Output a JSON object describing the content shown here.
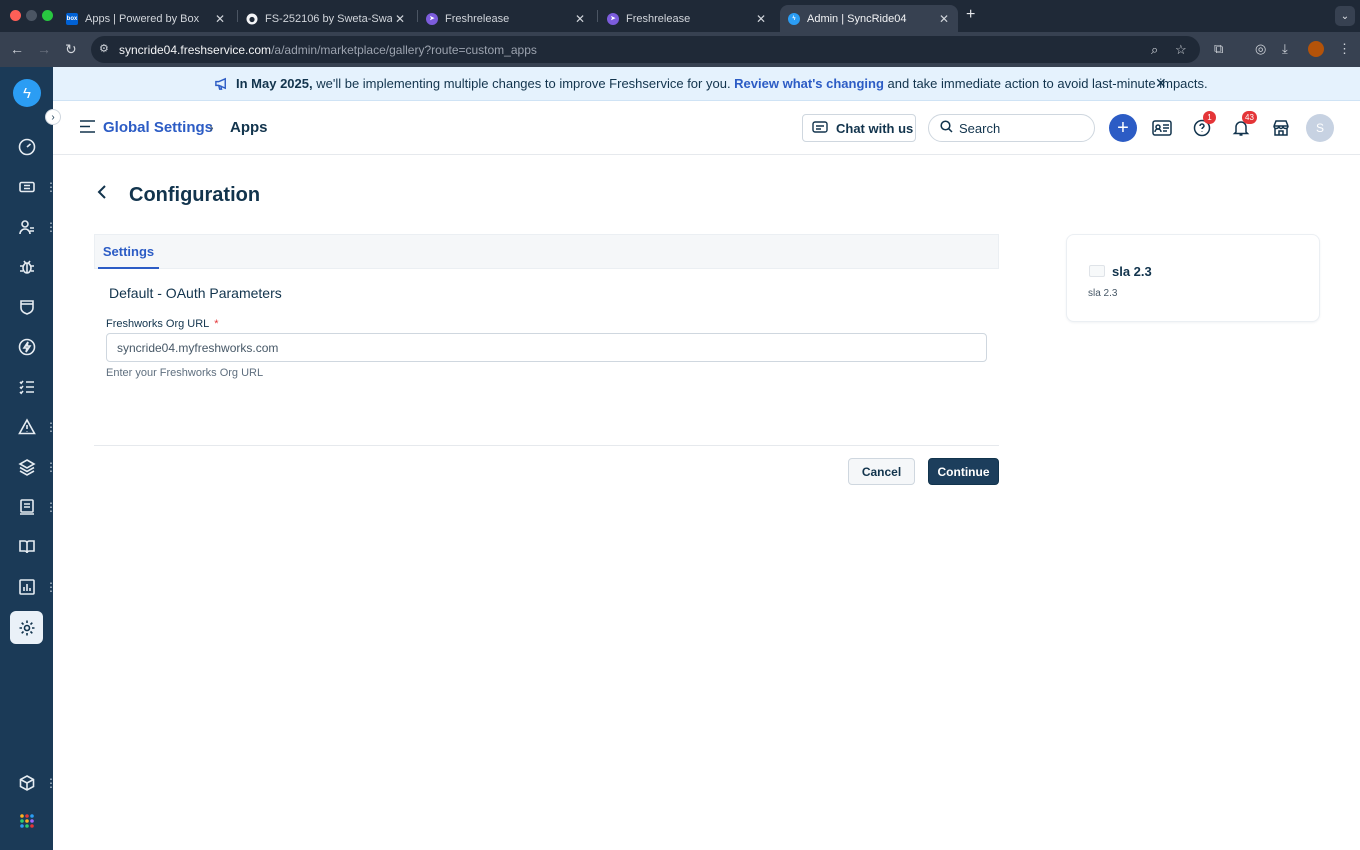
{
  "browser": {
    "tabs": [
      {
        "title": "Apps | Powered by Box",
        "favicon": "box-icon",
        "active": false
      },
      {
        "title": "FS-252106 by Sweta-Swarnam",
        "favicon": "github-icon",
        "active": false
      },
      {
        "title": "Freshrelease",
        "favicon": "freshrelease-icon",
        "active": false
      },
      {
        "title": "Freshrelease",
        "favicon": "freshrelease-icon",
        "active": false
      },
      {
        "title": "Admin | SyncRide04",
        "favicon": "freshservice-icon",
        "active": true
      }
    ],
    "url_host": "syncride04.freshservice.com",
    "url_path": "/a/admin/marketplace/gallery?route=custom_apps"
  },
  "banner": {
    "lead": "In May 2025,",
    "text": " we'll be implementing multiple changes to improve Freshservice for you. ",
    "link": "Review what's changing",
    "tail": " and take immediate action to avoid last-minute impacts."
  },
  "header": {
    "breadcrumb_parent": "Global Settings",
    "breadcrumb_current": "Apps",
    "chat_label": "Chat with us",
    "search_placeholder": "Search",
    "help_badge": "1",
    "notification_badge": "43",
    "avatar_initial": "S"
  },
  "page": {
    "title": "Configuration",
    "tab": "Settings",
    "section_title": "Default - OAuth Parameters",
    "field_label": "Freshworks Org URL",
    "required_mark": "*",
    "field_value": "syncride04.myfreshworks.com",
    "field_hint": "Enter your Freshworks Org URL",
    "cancel_label": "Cancel",
    "continue_label": "Continue"
  },
  "app_card": {
    "name": "sla 2.3",
    "description": "sla 2.3"
  },
  "colors": {
    "sidebar": "#1b3a57",
    "primary": "#2c5cc5",
    "banner_bg": "#e5f2fd",
    "continue_bg": "#1c3e5c"
  }
}
